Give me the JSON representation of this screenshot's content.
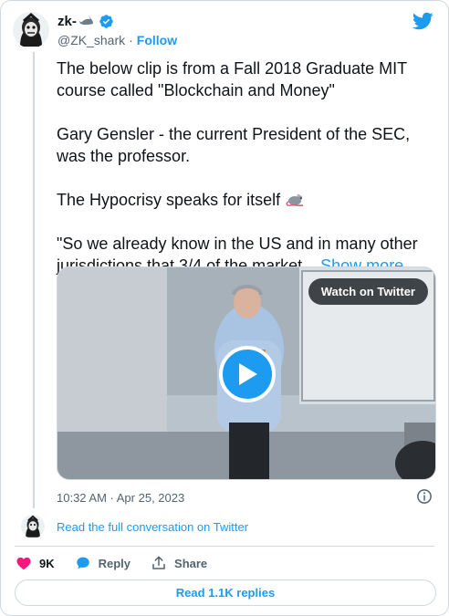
{
  "author": {
    "name": "zk-",
    "name_emoji": "shark-emoji",
    "verified": true,
    "handle": "@ZK_shark",
    "separator": "·",
    "follow_label": "Follow"
  },
  "tweet": {
    "paragraphs": [
      "The below clip is from a Fall 2018 Graduate MIT course called \"Blockchain and Money\"",
      "Gary Gensler - the current President of the SEC, was the professor.",
      "The Hypocrisy speaks for itself"
    ],
    "quote_text": "\"So we already know in the US and in many other jurisdictions that 3/4 of the market...",
    "show_more_label": "Show more",
    "inline_emoji": "rat-emoji"
  },
  "media": {
    "watch_label": "Watch on Twitter",
    "play_icon": "play-icon"
  },
  "meta": {
    "timestamp": "10:32 AM · Apr 25, 2023"
  },
  "conversation": {
    "link_label": "Read the full conversation on Twitter"
  },
  "actions": {
    "like_count": "9K",
    "reply_label": "Reply",
    "share_label": "Share"
  },
  "read_replies_label": "Read 1.1K replies",
  "colors": {
    "accent": "#1d9bf0",
    "like": "#f91880",
    "text": "#0f1419",
    "muted": "#536471",
    "border": "#cfd9de"
  }
}
